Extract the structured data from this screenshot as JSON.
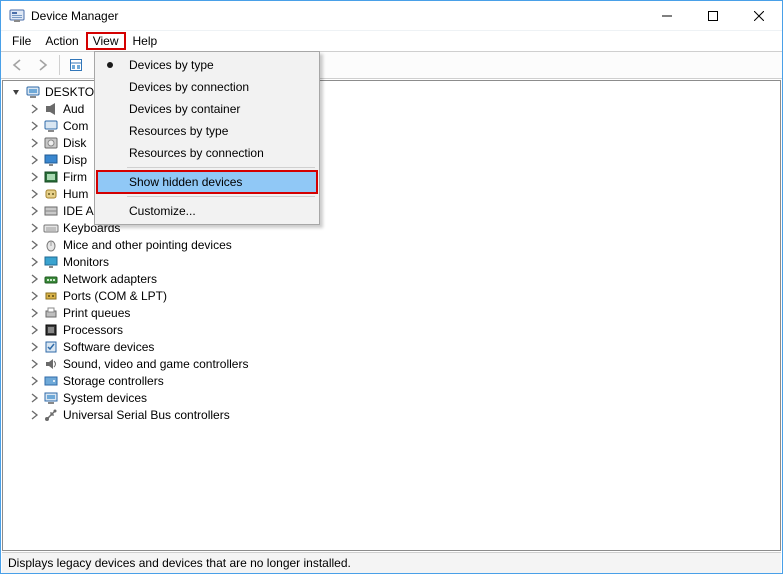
{
  "title": "Device Manager",
  "menubar": [
    "File",
    "Action",
    "View",
    "Help"
  ],
  "active_menu_index": 2,
  "view_menu": {
    "items": [
      {
        "label": "Devices by type",
        "selected": true
      },
      {
        "label": "Devices by connection",
        "selected": false
      },
      {
        "label": "Devices by container",
        "selected": false
      },
      {
        "label": "Resources by type",
        "selected": false
      },
      {
        "label": "Resources by connection",
        "selected": false
      }
    ],
    "show_hidden": "Show hidden devices",
    "customize": "Customize..."
  },
  "tree": {
    "root": {
      "label": "DESKTO",
      "expanded": true
    },
    "children": [
      {
        "label": "Aud",
        "icon": "audio"
      },
      {
        "label": "Com",
        "icon": "computer"
      },
      {
        "label": "Disk",
        "icon": "disk"
      },
      {
        "label": "Disp",
        "icon": "display"
      },
      {
        "label": "Firm",
        "icon": "firmware"
      },
      {
        "label": "Hum",
        "icon": "hid"
      },
      {
        "label": "IDE A",
        "icon": "ide"
      },
      {
        "label": "Keyboards",
        "icon": "keyboard"
      },
      {
        "label": "Mice and other pointing devices",
        "icon": "mouse"
      },
      {
        "label": "Monitors",
        "icon": "monitor"
      },
      {
        "label": "Network adapters",
        "icon": "network"
      },
      {
        "label": "Ports (COM & LPT)",
        "icon": "port"
      },
      {
        "label": "Print queues",
        "icon": "printer"
      },
      {
        "label": "Processors",
        "icon": "cpu"
      },
      {
        "label": "Software devices",
        "icon": "software"
      },
      {
        "label": "Sound, video and game controllers",
        "icon": "sound"
      },
      {
        "label": "Storage controllers",
        "icon": "storage"
      },
      {
        "label": "System devices",
        "icon": "system"
      },
      {
        "label": "Universal Serial Bus controllers",
        "icon": "usb"
      }
    ]
  },
  "statusbar": "Displays legacy devices and devices that are no longer installed.",
  "colors": {
    "accent": "#49a0e8",
    "highlight_red": "#d40000",
    "menu_highlight": "#90c8f6"
  }
}
